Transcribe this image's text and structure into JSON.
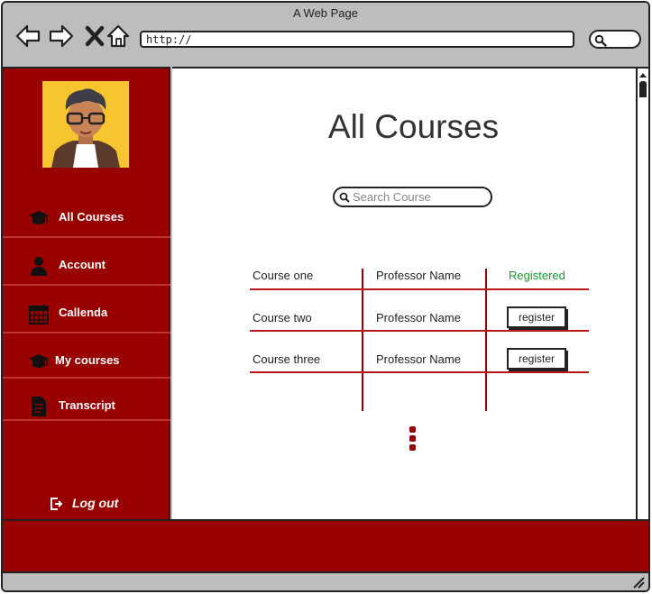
{
  "window": {
    "title": "A Web Page"
  },
  "browser": {
    "url": "http://"
  },
  "sidebar": {
    "items": [
      {
        "label": "All Courses",
        "icon": "graduation-cap-icon"
      },
      {
        "label": "Account",
        "icon": "user-icon"
      },
      {
        "label": "Callenda",
        "icon": "calendar-icon"
      },
      {
        "label": "My courses",
        "icon": "graduation-cap-icon"
      },
      {
        "label": "Transcript",
        "icon": "document-icon"
      }
    ],
    "logout_label": "Log out"
  },
  "main": {
    "title": "All Courses",
    "search_placeholder": "Search Course",
    "courses": [
      {
        "name": "Course one",
        "professor": "Professor Name",
        "status": "Registered",
        "action": ""
      },
      {
        "name": "Course two",
        "professor": "Professor Name",
        "status": "",
        "action": "register"
      },
      {
        "name": "Course three",
        "professor": "Professor Name",
        "status": "",
        "action": "register"
      }
    ]
  },
  "colors": {
    "brand": "#990000",
    "registered": "#1a9a2e",
    "chrome": "#bdbdbd"
  }
}
